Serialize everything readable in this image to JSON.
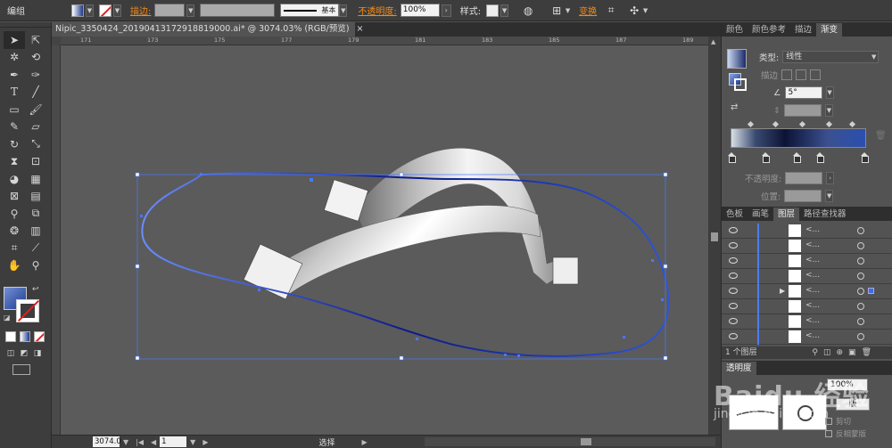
{
  "control_bar": {
    "mode_label": "编组",
    "stroke_label": "描边:",
    "stroke_style_label": "基本",
    "opacity_label": "不透明度:",
    "opacity_value": "100%",
    "style_label": "样式:",
    "transform_label": "变换"
  },
  "document_tab": {
    "title": "Nipic_3350424_20190413172918819000.ai* @ 3074.03% (RGB/预览)",
    "close": "×"
  },
  "ruler_marks": [
    "171",
    "173",
    "175",
    "177",
    "179",
    "181",
    "183",
    "185",
    "187",
    "189"
  ],
  "gradient_panel": {
    "tabs": [
      "颜色",
      "颜色参考",
      "描边",
      "渐变"
    ],
    "type_label": "类型:",
    "type_value": "线性",
    "stroke_label": "描边",
    "angle_value": "5°",
    "opacity_label": "不透明度:",
    "position_label": "位置:"
  },
  "layers_panel": {
    "tabs": [
      "色板",
      "画笔",
      "图层",
      "路径查找器"
    ],
    "layer_count": "1 个图层",
    "rows": [
      {
        "name": "<..."
      },
      {
        "name": "<..."
      },
      {
        "name": "<..."
      },
      {
        "name": "<..."
      },
      {
        "name": "<..."
      },
      {
        "name": "<..."
      },
      {
        "name": "<..."
      },
      {
        "name": "<..."
      }
    ]
  },
  "transparency_panel": {
    "tabs": [
      "透明度"
    ],
    "opacity_value": "100%",
    "make_mask_button": "版",
    "clip_label": "剪切",
    "invert_label": "反相蒙版"
  },
  "status_bar": {
    "zoom": "3074.0",
    "page": "1",
    "status": "选择"
  },
  "watermark": {
    "text": "Baidu 经验",
    "subtext": "jingyan.baidu.com"
  },
  "colors": {
    "accent_orange": "#f08a1a",
    "selection_blue": "#3a6df0",
    "path_blue": "#2f55d4",
    "panel_bg": "#535353"
  }
}
